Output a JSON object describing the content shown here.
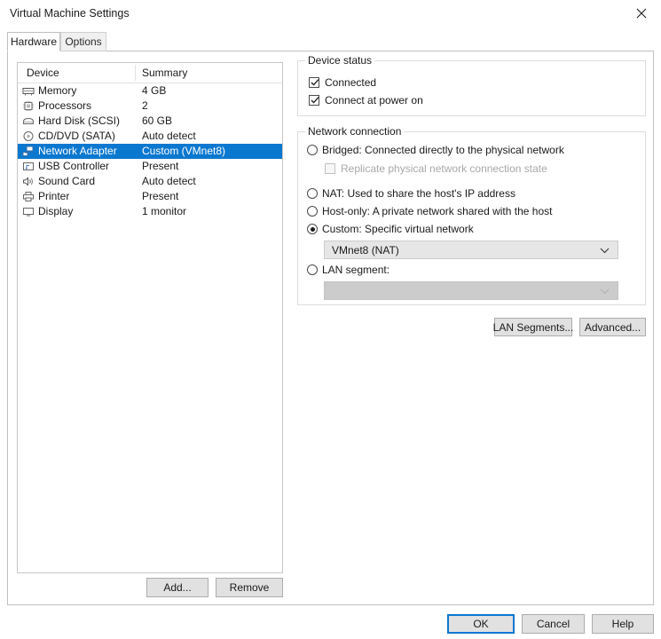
{
  "window": {
    "title": "Virtual Machine Settings",
    "close_icon": "close-icon"
  },
  "tabs": [
    {
      "label": "Hardware",
      "active": true
    },
    {
      "label": "Options",
      "active": false
    }
  ],
  "device_list": {
    "columns": [
      "Device",
      "Summary"
    ],
    "rows": [
      {
        "icon": "memory-icon",
        "device": "Memory",
        "summary": "4 GB",
        "selected": false
      },
      {
        "icon": "processor-icon",
        "device": "Processors",
        "summary": "2",
        "selected": false
      },
      {
        "icon": "hard-disk-icon",
        "device": "Hard Disk (SCSI)",
        "summary": "60 GB",
        "selected": false
      },
      {
        "icon": "cd-dvd-icon",
        "device": "CD/DVD (SATA)",
        "summary": "Auto detect",
        "selected": false
      },
      {
        "icon": "network-adapter-icon",
        "device": "Network Adapter",
        "summary": "Custom (VMnet8)",
        "selected": true
      },
      {
        "icon": "usb-controller-icon",
        "device": "USB Controller",
        "summary": "Present",
        "selected": false
      },
      {
        "icon": "sound-card-icon",
        "device": "Sound Card",
        "summary": "Auto detect",
        "selected": false
      },
      {
        "icon": "printer-icon",
        "device": "Printer",
        "summary": "Present",
        "selected": false
      },
      {
        "icon": "display-icon",
        "device": "Display",
        "summary": "1 monitor",
        "selected": false
      }
    ],
    "add_label": "Add...",
    "remove_label": "Remove"
  },
  "device_status": {
    "legend": "Device status",
    "connected_label": "Connected",
    "connected_checked": true,
    "power_on_label": "Connect at power on",
    "power_on_checked": true
  },
  "network_connection": {
    "legend": "Network connection",
    "bridged_label": "Bridged: Connected directly to the physical network",
    "replicate_label": "Replicate physical network connection state",
    "replicate_checked": false,
    "replicate_enabled": false,
    "nat_label": "NAT: Used to share the host's IP address",
    "hostonly_label": "Host-only: A private network shared with the host",
    "custom_label": "Custom: Specific virtual network",
    "custom_selected": true,
    "vmnet_value": "VMnet8 (NAT)",
    "lan_segment_label": "LAN segment:",
    "lan_segment_value": "",
    "lan_segment_enabled": false
  },
  "side_buttons": {
    "lan_segments_label": "LAN Segments...",
    "advanced_label": "Advanced..."
  },
  "footer": {
    "ok_label": "OK",
    "cancel_label": "Cancel",
    "help_label": "Help"
  },
  "colors": {
    "selection_blue": "#0b78d0",
    "button_face": "#e1e1e1",
    "disabled_text": "#a8a8a8"
  }
}
